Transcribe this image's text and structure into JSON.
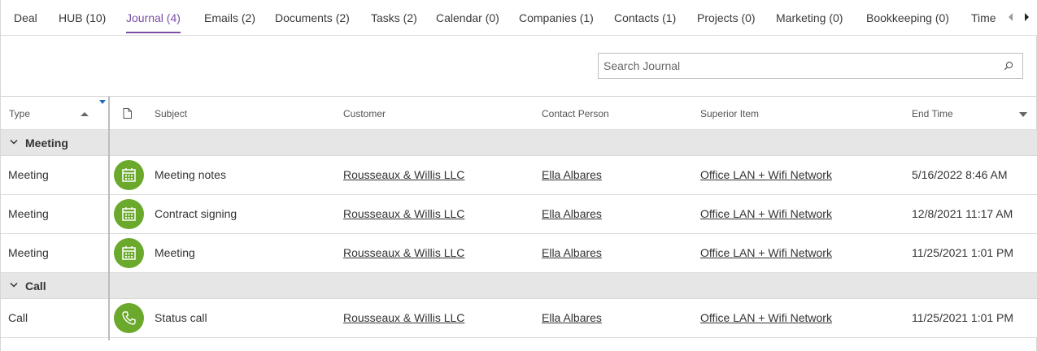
{
  "tabs": [
    {
      "label": "Deal"
    },
    {
      "label": "HUB (10)"
    },
    {
      "label": "Journal (4)",
      "active": true
    },
    {
      "label": "Emails (2)"
    },
    {
      "label": "Documents (2)"
    },
    {
      "label": "Tasks (2)"
    },
    {
      "label": "Calendar (0)"
    },
    {
      "label": "Companies (1)"
    },
    {
      "label": "Contacts (1)"
    },
    {
      "label": "Projects (0)"
    },
    {
      "label": "Marketing (0)"
    },
    {
      "label": "Bookkeeping (0)"
    },
    {
      "label": "Time"
    }
  ],
  "search": {
    "placeholder": "Search Journal",
    "value": ""
  },
  "columns": {
    "type": "Type",
    "subject": "Subject",
    "customer": "Customer",
    "contact": "Contact Person",
    "superior": "Superior Item",
    "end_time": "End Time"
  },
  "groups": [
    {
      "label": "Meeting",
      "rows": [
        {
          "type": "Meeting",
          "icon": "calendar-icon",
          "subject": "Meeting notes",
          "customer": "Rousseaux & Willis LLC",
          "contact": "Ella Albares",
          "superior": "Office LAN + Wifi Network",
          "end_time": "5/16/2022 8:46 AM"
        },
        {
          "type": "Meeting",
          "icon": "calendar-icon",
          "subject": "Contract signing",
          "customer": "Rousseaux & Willis LLC",
          "contact": "Ella Albares",
          "superior": "Office LAN + Wifi Network",
          "end_time": "12/8/2021 11:17 AM"
        },
        {
          "type": "Meeting",
          "icon": "calendar-icon",
          "subject": "Meeting",
          "customer": "Rousseaux & Willis LLC",
          "contact": "Ella Albares",
          "superior": "Office LAN + Wifi Network",
          "end_time": "11/25/2021 1:01 PM"
        }
      ]
    },
    {
      "label": "Call",
      "rows": [
        {
          "type": "Call",
          "icon": "phone-icon",
          "subject": "Status call",
          "customer": "Rousseaux & Willis LLC",
          "contact": "Ella Albares",
          "superior": "Office LAN + Wifi Network",
          "end_time": "11/25/2021 1:01 PM"
        }
      ]
    }
  ],
  "colors": {
    "accent": "#7b4fa8",
    "icon_bg": "#6aa92c",
    "group_bg": "#e6e6e6"
  }
}
